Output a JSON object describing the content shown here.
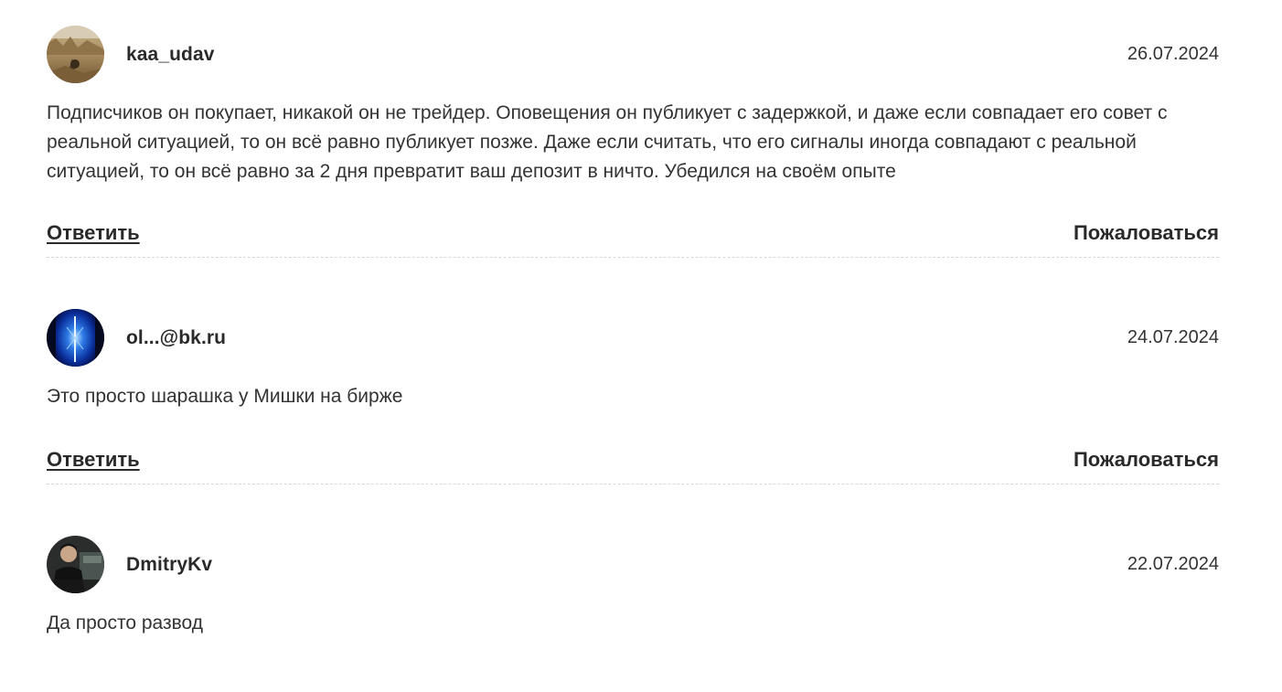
{
  "comments": [
    {
      "author": "kaa_udav",
      "date": "26.07.2024",
      "text": "Подписчиков он покупает, никакой он не трейдер. Оповещения он публикует с задержкой, и даже если совпадает его совет с реальной ситуацией, то он всё равно публикует позже. Даже если считать, что его сигналы иногда совпадают с реальной ситуацией, то он всё равно за 2 дня превратит ваш депозит в ничто. Убедился на своём опыте",
      "reply_label": "Ответить",
      "report_label": "Пожаловаться",
      "avatar_icon": "landscape-photo-avatar"
    },
    {
      "author": "ol...@bk.ru",
      "date": "24.07.2024",
      "text": "Это просто шарашка у Мишки на бирже",
      "reply_label": "Ответить",
      "report_label": "Пожаловаться",
      "avatar_icon": "blue-light-avatar"
    },
    {
      "author": "DmitryKv",
      "date": "22.07.2024",
      "text": "Да просто развод",
      "avatar_icon": "person-photo-avatar"
    }
  ]
}
